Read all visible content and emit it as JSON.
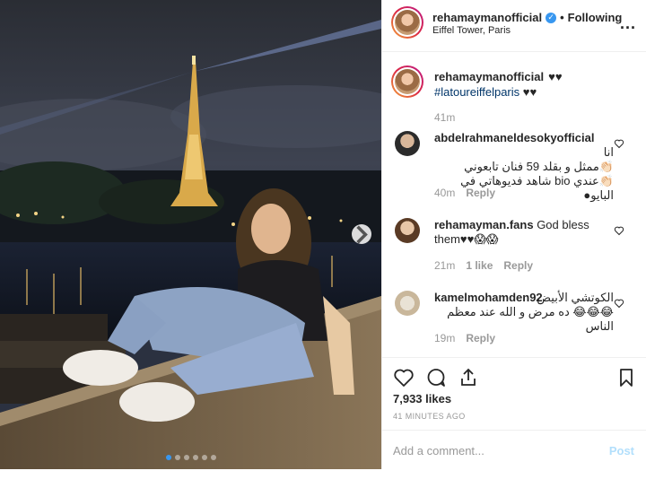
{
  "header": {
    "username": "rehamaymanofficial",
    "separator": "•",
    "follow_label": "Following",
    "location": "Eiffel Tower, Paris",
    "more_label": "..."
  },
  "caption": {
    "username": "rehamaymanofficial",
    "user_hearts": "♥♥",
    "hashtag": "#latoureiffelparis",
    "tag_hearts": "♥♥",
    "time": "41m"
  },
  "comments": [
    {
      "username": "abdelrahmaneldesokyofficial",
      "text": "انا\n👏🏻ممثل و بقلد 59 فنان تابعوني\n👏🏻عندي bio شاهد فديوهاتي في البايو●",
      "time": "40m",
      "reply_label": "Reply"
    },
    {
      "username": "rehamayman.fans",
      "text": "God bless them♥♥😱😱",
      "time": "21m",
      "likes": "1 like",
      "reply_label": "Reply"
    },
    {
      "username": "kamelmohamden92",
      "text": "الكوتشي الأبيض\n😂😂😂 ده مرض و الله عند معظم الناس",
      "time": "19m",
      "reply_label": "Reply"
    }
  ],
  "post": {
    "likes": "7,933 likes",
    "time": "41 MINUTES AGO",
    "comment_placeholder": "Add a comment...",
    "post_label": "Post"
  },
  "carousel": {
    "slide_count": 6,
    "active_index": 0
  },
  "colors": {
    "accent": "#3897f0",
    "hashtag": "#003569",
    "muted": "#999999",
    "post_disabled": "#b2dffc"
  }
}
